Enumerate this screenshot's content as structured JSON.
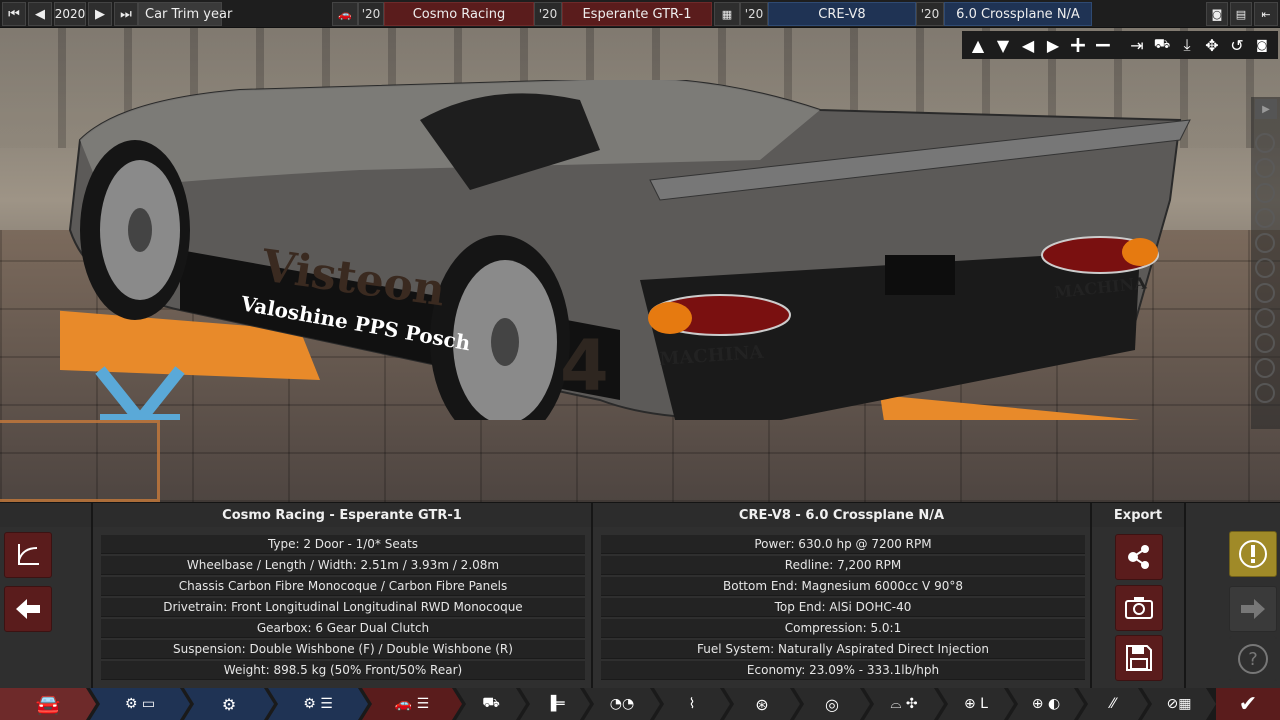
{
  "topbar": {
    "year": "2020",
    "trim_label": "Car Trim year",
    "car_year_1": "'20",
    "company": "Cosmo Racing",
    "car_year_2": "'20",
    "model": "Esperante GTR-1",
    "engine_year_1": "'20",
    "engine_family": "CRE-V8",
    "engine_year_2": "'20",
    "variant": "6.0 Crossplane N/A"
  },
  "car_panel": {
    "title": "Cosmo Racing - Esperante GTR-1",
    "rows": [
      "Type: 2 Door - 1/0* Seats",
      "Wheelbase / Length / Width: 2.51m / 3.93m / 2.08m",
      "Chassis Carbon Fibre Monocoque / Carbon Fibre Panels",
      "Drivetrain: Front Longitudinal Longitudinal RWD Monocoque",
      "Gearbox: 6 Gear Dual Clutch",
      "Suspension: Double Wishbone (F) / Double Wishbone (R)",
      "Weight: 898.5 kg (50% Front/50% Rear)"
    ]
  },
  "engine_panel": {
    "title": "CRE-V8 - 6.0 Crossplane N/A",
    "rows": [
      "Power: 630.0 hp @ 7200 RPM",
      "Redline:  7,200 RPM",
      "Bottom End: Magnesium 6000cc V 90°8",
      "Top End: AlSi DOHC-40",
      "Compression: 5.0:1",
      "Fuel System: Naturally Aspirated Direct Injection",
      "Economy: 23.09% - 333.1lb/hph"
    ]
  },
  "export_panel": {
    "title": "Export"
  },
  "livery": {
    "sponsor1": "Visteon",
    "sponsor2": "Valoshine  PPS Posch",
    "number": "4",
    "badge": "MACHINA"
  },
  "colors": {
    "accent_red": "#5a1c1c",
    "accent_blue": "#1f3354",
    "gold": "#a08a28",
    "lift_orange": "#e88a2a",
    "lift_blue": "#5aa9d8"
  }
}
